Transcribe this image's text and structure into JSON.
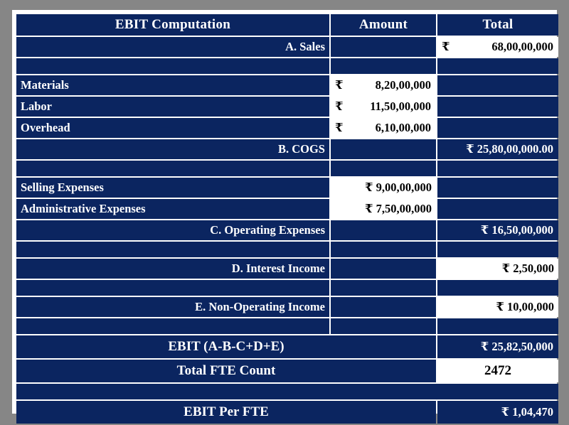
{
  "table": {
    "headers": {
      "label": "EBIT Computation",
      "amount": "Amount",
      "total": "Total"
    },
    "currency_symbol": "₹",
    "rows": {
      "sales_label": "A. Sales",
      "sales_total_cur": "₹",
      "sales_total_val": "68,00,00,000",
      "materials_label": "Materials",
      "materials_amount_cur": "₹",
      "materials_amount_val": "8,20,00,000",
      "labor_label": "Labor",
      "labor_amount_cur": "₹",
      "labor_amount_val": "11,50,00,000",
      "overhead_label": "Overhead",
      "overhead_amount_cur": "₹",
      "overhead_amount_val": "6,10,00,000",
      "cogs_label": "B. COGS",
      "cogs_total": "₹ 25,80,00,000.00",
      "selling_label": "Selling Expenses",
      "selling_amount": "₹ 9,00,00,000",
      "admin_label": "Administrative Expenses",
      "admin_amount": "₹ 7,50,00,000",
      "opex_label": "C. Operating Expenses",
      "opex_total": "₹ 16,50,00,000",
      "interest_label": "D. Interest Income",
      "interest_total": "₹ 2,50,000",
      "nonop_label": "E. Non-Operating Income",
      "nonop_total": "₹ 10,00,000",
      "ebit_label": "EBIT (A-B-C+D+E)",
      "ebit_total": "₹ 25,82,50,000",
      "fte_label": "Total FTE Count",
      "fte_value": "2472",
      "ebit_per_fte_label": "EBIT Per FTE",
      "ebit_per_fte_value": "₹ 1,04,470"
    }
  },
  "colors": {
    "navy": "#0b2560",
    "gridline": "#ffffff",
    "page_background": "#868686",
    "value_cell": "#ffffff"
  }
}
